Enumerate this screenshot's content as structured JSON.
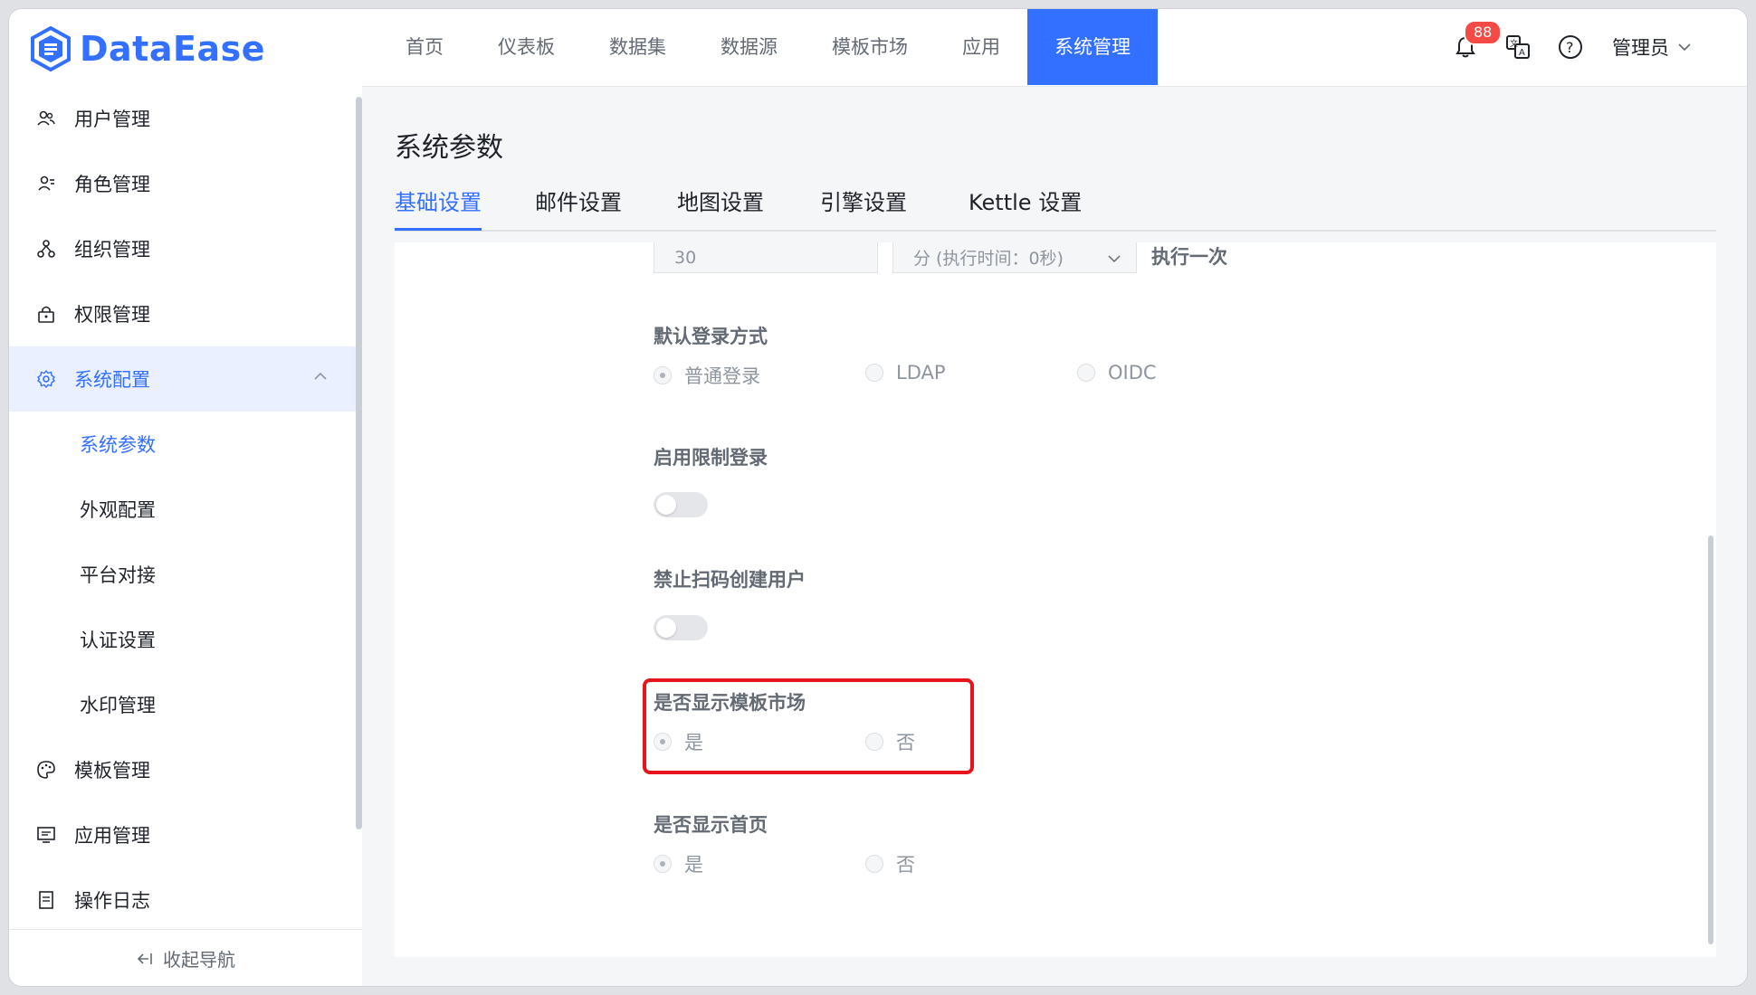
{
  "app": {
    "logo_text": "DataEase"
  },
  "nav": {
    "items": [
      "首页",
      "仪表板",
      "数据集",
      "数据源",
      "模板市场",
      "应用",
      "系统管理"
    ],
    "active_index": 6
  },
  "header": {
    "notification_count": "88",
    "user_label": "管理员"
  },
  "sidebar": {
    "items": [
      {
        "label": "用户管理",
        "icon": "users-icon"
      },
      {
        "label": "角色管理",
        "icon": "role-icon"
      },
      {
        "label": "组织管理",
        "icon": "org-icon"
      },
      {
        "label": "权限管理",
        "icon": "lock-icon"
      },
      {
        "label": "系统配置",
        "icon": "gear-icon"
      },
      {
        "label": "模板管理",
        "icon": "palette-icon"
      },
      {
        "label": "应用管理",
        "icon": "app-icon"
      },
      {
        "label": "操作日志",
        "icon": "log-icon"
      }
    ],
    "sub_items": [
      "系统参数",
      "外观配置",
      "平台对接",
      "认证设置",
      "水印管理"
    ],
    "active_sub": "系统参数",
    "collapse_label": "收起导航"
  },
  "page": {
    "title": "系统参数",
    "tabs": [
      "基础设置",
      "邮件设置",
      "地图设置",
      "引擎设置",
      "Kettle 设置"
    ],
    "active_tab": 0
  },
  "form": {
    "interval_value": "30",
    "interval_unit": "分 (执行时间：0秒)",
    "interval_suffix": "执行一次",
    "login_method": {
      "label": "默认登录方式",
      "options": [
        "普通登录",
        "LDAP",
        "OIDC"
      ],
      "selected": 0
    },
    "limit_login": {
      "label": "启用限制登录",
      "enabled": false
    },
    "disable_scan_create": {
      "label": "禁止扫码创建用户",
      "enabled": false
    },
    "show_template_market": {
      "label": "是否显示模板市场",
      "options": [
        "是",
        "否"
      ],
      "selected": 0
    },
    "show_home": {
      "label": "是否显示首页",
      "options": [
        "是",
        "否"
      ],
      "selected": 0
    }
  },
  "colors": {
    "accent": "#3370ff",
    "highlight": "#e8141b",
    "badge": "#f54a45"
  }
}
